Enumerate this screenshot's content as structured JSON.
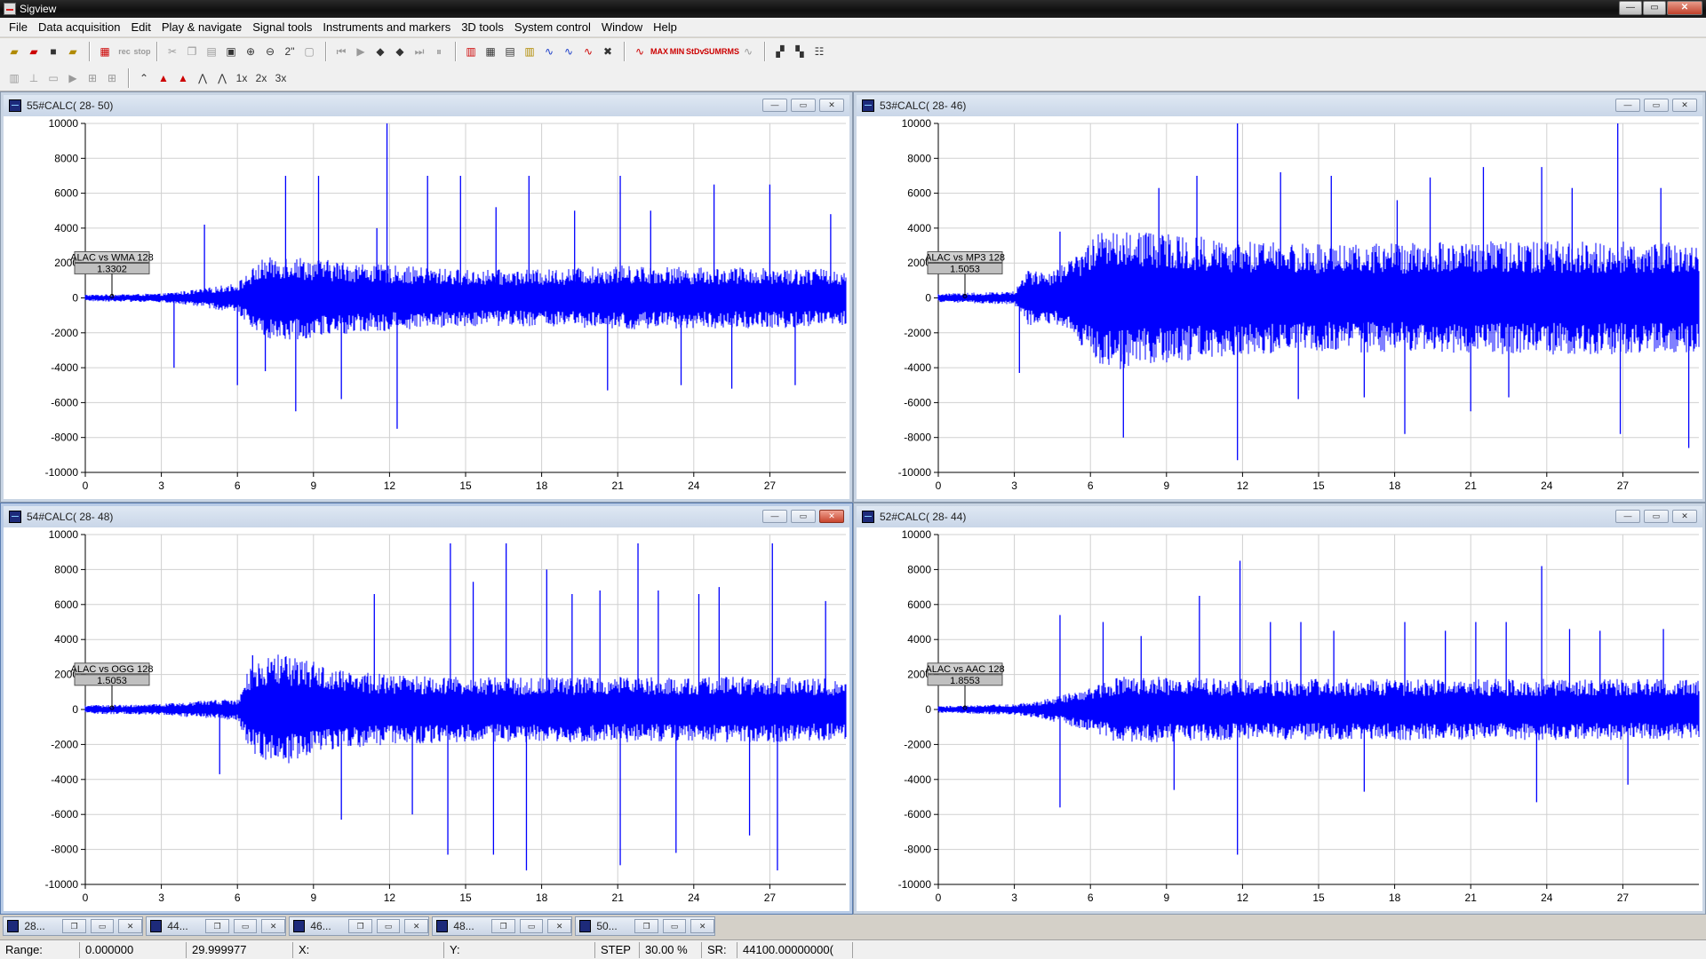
{
  "window": {
    "title": "Sigview",
    "minimize": "—",
    "maximize": "▭",
    "close": "✕"
  },
  "menu": [
    "File",
    "Data acquisition",
    "Edit",
    "Play & navigate",
    "Signal tools",
    "Instruments and markers",
    "3D tools",
    "System control",
    "Window",
    "Help"
  ],
  "toolbar": {
    "rec": "rec",
    "stop": "stop",
    "zoom_2": "2\"",
    "max": "MAX",
    "min": "MIN",
    "stdev": "StDv",
    "sum": "SUM",
    "rms": "RMS",
    "x1": "1x",
    "x2": "2x",
    "x3": "3x"
  },
  "axis": {
    "y_ticks": [
      "10000",
      "8000",
      "6000",
      "4000",
      "2000",
      "0",
      "-2000",
      "-4000",
      "-6000",
      "-8000",
      "-10000"
    ],
    "x_ticks": [
      "0",
      "3",
      "6",
      "9",
      "12",
      "15",
      "18",
      "21",
      "24",
      "27"
    ]
  },
  "charts": [
    {
      "window_title": "55#CALC( 28- 50)",
      "marker_label": "ALAC vs WMA 128",
      "marker_value": "1.3302",
      "active": false,
      "close_highlight": false
    },
    {
      "window_title": "53#CALC( 28- 46)",
      "marker_label": "ALAC vs MP3 128",
      "marker_value": "1.5053",
      "active": false,
      "close_highlight": false
    },
    {
      "window_title": "54#CALC( 28- 48)",
      "marker_label": "ALAC vs OGG 128",
      "marker_value": "1.5053",
      "active": true,
      "close_highlight": true
    },
    {
      "window_title": "52#CALC( 28- 44)",
      "marker_label": "ALAC vs AAC 128",
      "marker_value": "1.8553",
      "active": false,
      "close_highlight": false
    }
  ],
  "chart_data": [
    {
      "type": "line",
      "title": "55#CALC( 28- 50)",
      "series": [
        {
          "name": "ALAC vs WMA 128",
          "color": "#0000ff"
        }
      ],
      "xlim": [
        0,
        30
      ],
      "ylim": [
        -10000,
        10000
      ],
      "grid": true,
      "envelope": {
        "t": [
          0,
          3,
          4.5,
          6,
          7,
          8,
          9,
          12,
          15,
          18,
          21,
          24,
          27,
          30
        ],
        "amp": [
          150,
          200,
          400,
          700,
          1800,
          2000,
          1800,
          1500,
          1300,
          1300,
          1500,
          1400,
          1400,
          1300
        ]
      },
      "spikes": [
        [
          3.5,
          -4000
        ],
        [
          4.7,
          4200
        ],
        [
          6,
          -5000
        ],
        [
          7.1,
          -4200
        ],
        [
          7.9,
          7000
        ],
        [
          8.3,
          -6500
        ],
        [
          9.2,
          7000
        ],
        [
          10.1,
          -5800
        ],
        [
          11.5,
          4000
        ],
        [
          11.9,
          10000
        ],
        [
          12.3,
          -7500
        ],
        [
          13.5,
          7000
        ],
        [
          14.8,
          7000
        ],
        [
          16.2,
          5200
        ],
        [
          17.5,
          7000
        ],
        [
          19.3,
          5000
        ],
        [
          20.6,
          -5300
        ],
        [
          21.1,
          7000
        ],
        [
          22.3,
          5000
        ],
        [
          23.5,
          -5000
        ],
        [
          24.8,
          6500
        ],
        [
          25.5,
          -5200
        ],
        [
          27,
          6500
        ],
        [
          28,
          -5000
        ],
        [
          29.4,
          4800
        ]
      ]
    },
    {
      "type": "line",
      "title": "53#CALC( 28- 46)",
      "series": [
        {
          "name": "ALAC vs MP3 128",
          "color": "#0000ff"
        }
      ],
      "xlim": [
        0,
        30
      ],
      "ylim": [
        -10000,
        10000
      ],
      "grid": true,
      "envelope": {
        "t": [
          0,
          3,
          3.5,
          4.5,
          5.5,
          6.5,
          7,
          9,
          12,
          15,
          18,
          21,
          24,
          27,
          30
        ],
        "amp": [
          200,
          300,
          1300,
          1200,
          2000,
          3200,
          3300,
          3000,
          2600,
          2500,
          2500,
          2600,
          2600,
          2600,
          2500
        ]
      },
      "spikes": [
        [
          3.2,
          -4300
        ],
        [
          4.8,
          3800
        ],
        [
          7.3,
          -8000
        ],
        [
          8.7,
          6300
        ],
        [
          10.2,
          7000
        ],
        [
          11.8,
          -9300
        ],
        [
          11.8,
          10000
        ],
        [
          13.5,
          7200
        ],
        [
          14.2,
          -5800
        ],
        [
          15.5,
          7000
        ],
        [
          16.8,
          -5700
        ],
        [
          18.1,
          5600
        ],
        [
          18.4,
          -7800
        ],
        [
          19.4,
          6900
        ],
        [
          21,
          -6500
        ],
        [
          21.5,
          7500
        ],
        [
          22.5,
          -5700
        ],
        [
          23.8,
          7500
        ],
        [
          25,
          6300
        ],
        [
          26.8,
          10000
        ],
        [
          26.9,
          -7800
        ],
        [
          28.5,
          6300
        ],
        [
          29.6,
          -8600
        ]
      ]
    },
    {
      "type": "line",
      "title": "54#CALC( 28- 48)",
      "series": [
        {
          "name": "ALAC vs OGG 128",
          "color": "#0000ff"
        }
      ],
      "xlim": [
        0,
        30
      ],
      "ylim": [
        -10000,
        10000
      ],
      "grid": true,
      "envelope": {
        "t": [
          0,
          3,
          4,
          6,
          6.5,
          7.5,
          9,
          10,
          12,
          15,
          18,
          21,
          24,
          27,
          30
        ],
        "amp": [
          200,
          250,
          350,
          500,
          2000,
          2600,
          2200,
          1800,
          1600,
          1500,
          1500,
          1500,
          1500,
          1500,
          1400
        ]
      },
      "spikes": [
        [
          5.3,
          -3700
        ],
        [
          6.6,
          3100
        ],
        [
          10.1,
          -6300
        ],
        [
          11.4,
          6600
        ],
        [
          12.9,
          -6000
        ],
        [
          14.3,
          -8300
        ],
        [
          14.4,
          9500
        ],
        [
          15.3,
          7300
        ],
        [
          16.1,
          -8300
        ],
        [
          16.6,
          9500
        ],
        [
          17.4,
          -9200
        ],
        [
          18.2,
          8000
        ],
        [
          19.2,
          6600
        ],
        [
          20.3,
          6800
        ],
        [
          21.1,
          -8900
        ],
        [
          21.8,
          9500
        ],
        [
          22.6,
          6800
        ],
        [
          23.3,
          -8200
        ],
        [
          24.2,
          6600
        ],
        [
          25,
          7000
        ],
        [
          26.2,
          -7200
        ],
        [
          27.1,
          9500
        ],
        [
          27.3,
          -9200
        ],
        [
          29.2,
          6200
        ]
      ]
    },
    {
      "type": "line",
      "title": "52#CALC( 28- 44)",
      "series": [
        {
          "name": "ALAC vs AAC 128",
          "color": "#0000ff"
        }
      ],
      "xlim": [
        0,
        30
      ],
      "ylim": [
        -10000,
        10000
      ],
      "grid": true,
      "envelope": {
        "t": [
          0,
          3,
          4,
          6,
          7,
          9,
          12,
          15,
          18,
          21,
          24,
          27,
          30
        ],
        "amp": [
          150,
          250,
          400,
          1000,
          1500,
          1500,
          1400,
          1400,
          1400,
          1400,
          1400,
          1400,
          1400
        ]
      },
      "spikes": [
        [
          4.8,
          5400
        ],
        [
          4.8,
          -5600
        ],
        [
          6.5,
          5000
        ],
        [
          8,
          4200
        ],
        [
          9.3,
          -4600
        ],
        [
          10.3,
          6500
        ],
        [
          11.8,
          -8300
        ],
        [
          11.9,
          8500
        ],
        [
          13.1,
          5000
        ],
        [
          14.3,
          5000
        ],
        [
          15.6,
          4500
        ],
        [
          16.8,
          -4700
        ],
        [
          18.4,
          5000
        ],
        [
          20,
          4500
        ],
        [
          21.2,
          5000
        ],
        [
          22.4,
          5000
        ],
        [
          23.6,
          -5300
        ],
        [
          23.8,
          8200
        ],
        [
          24.9,
          4600
        ],
        [
          26.1,
          4500
        ],
        [
          27.2,
          -4300
        ],
        [
          28.6,
          4600
        ]
      ]
    }
  ],
  "minimized": [
    "28...",
    "44...",
    "46...",
    "48...",
    "50..."
  ],
  "status": {
    "range_label": "Range:",
    "range_from": "0.000000",
    "range_to": "29.999977",
    "x_label": "X:",
    "y_label": "Y:",
    "step_label": "STEP",
    "step_value": "30.00 %",
    "sr_label": "SR:",
    "sr_value": "44100.00000000("
  },
  "colors": {
    "signal": "#0000ff",
    "grid": "#d0d0d0",
    "marker_box": "#c8c8c8"
  }
}
